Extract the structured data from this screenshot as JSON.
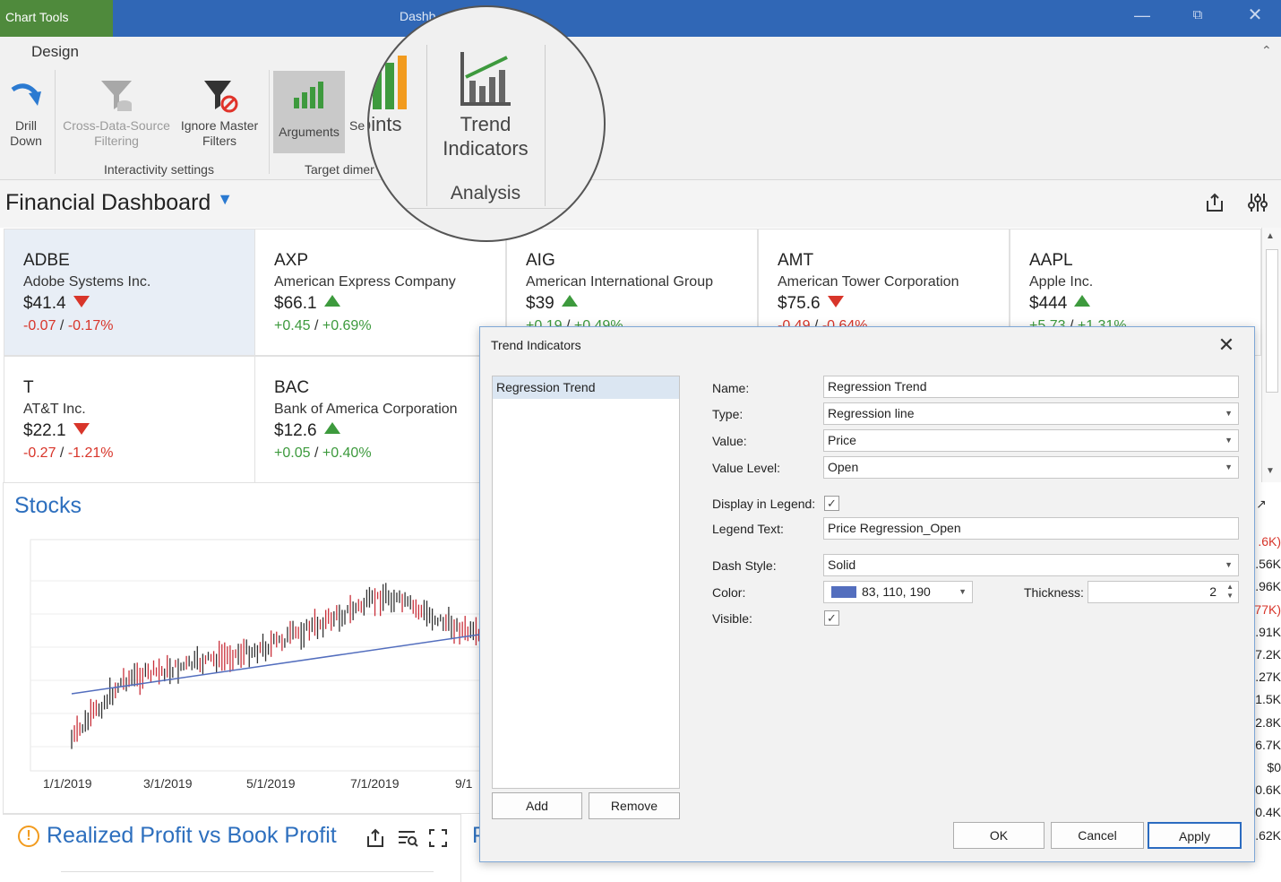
{
  "window": {
    "context_tab": "Chart Tools",
    "title": "Dashb",
    "min_icon": "minimize-icon",
    "restore_icon": "restore-icon",
    "close_icon": "close-icon"
  },
  "ribbon": {
    "tab": "Design",
    "buttons": [
      {
        "l1": "Drill",
        "l2": "Down"
      },
      {
        "l1": "Cross-Data-Source",
        "l2": "Filtering"
      },
      {
        "l1": "Ignore Master",
        "l2": "Filters"
      },
      {
        "l1": "Arguments"
      },
      {
        "l1": "Se"
      }
    ],
    "groups": {
      "interactivity": "Interactivity settings",
      "target": "Target dimer"
    },
    "magnifier": {
      "points": "oints",
      "trend_l1": "Trend",
      "trend_l2": "Indicators",
      "analysis": "Analysis"
    }
  },
  "dashboard": {
    "title": "Financial Dashboard",
    "filter_icon": "filter-icon",
    "export_icon": "export-icon",
    "settings_icon": "parameters-icon"
  },
  "tiles": [
    {
      "ticker": "ADBE",
      "name": "Adobe Systems Inc.",
      "price": "$41.4",
      "dir": "down",
      "delta": "-0.07",
      "pct": "-0.17%"
    },
    {
      "ticker": "AXP",
      "name": "American Express Company",
      "price": "$66.1",
      "dir": "up",
      "delta": "+0.45",
      "pct": "+0.69%"
    },
    {
      "ticker": "AIG",
      "name": "American International Group",
      "price": "$39",
      "dir": "up",
      "delta": "+0.19",
      "pct": "+0.49%"
    },
    {
      "ticker": "AMT",
      "name": "American Tower Corporation",
      "price": "$75.6",
      "dir": "down",
      "delta": "-0.49",
      "pct": "-0.64%"
    },
    {
      "ticker": "AAPL",
      "name": "Apple Inc.",
      "price": "$444",
      "dir": "up",
      "delta": "+5.73",
      "pct": "+1.31%"
    },
    {
      "ticker": "T",
      "name": "AT&T Inc.",
      "price": "$22.1",
      "dir": "down",
      "delta": "-0.27",
      "pct": "-1.21%"
    },
    {
      "ticker": "BAC",
      "name": "Bank of America Corporation",
      "price": "$12.6",
      "dir": "up",
      "delta": "+0.05",
      "pct": "+0.40%"
    }
  ],
  "stocks": {
    "title": "Stocks",
    "x_ticks": [
      "1/1/2019",
      "3/1/2019",
      "5/1/2019",
      "7/1/2019",
      "9/1"
    ]
  },
  "profit": {
    "title": "Realized Profit vs Book Profit",
    "warn_icon": "warning-icon",
    "export_icon": "export-icon",
    "filter_icon": "filter-list-icon",
    "expand_icon": "expand-icon",
    "cut_letter": "P"
  },
  "right_values": [
    ".6K)",
    ".56K",
    ".96K",
    ".77K)",
    ".91K",
    "7.2K",
    ".27K",
    "1.5K",
    "2.8K",
    "6.7K",
    "$0",
    "0.6K",
    "0.4K",
    ".62K"
  ],
  "dialog": {
    "title": "Trend Indicators",
    "list": [
      "Regression Trend"
    ],
    "add": "Add",
    "remove": "Remove",
    "labels": {
      "name": "Name:",
      "type": "Type:",
      "value": "Value:",
      "level": "Value Level:",
      "legend": "Display in Legend:",
      "legend_text": "Legend Text:",
      "dash": "Dash Style:",
      "color": "Color:",
      "thickness": "Thickness:",
      "visible": "Visible:"
    },
    "values": {
      "name": "Regression Trend",
      "type": "Regression line",
      "value": "Price",
      "level": "Open",
      "legend_text": "Price Regression_Open",
      "dash": "Solid",
      "color": "83, 110, 190",
      "color_hex": "#536ebe",
      "thickness": "2"
    },
    "checks": {
      "legend": true,
      "visible": true
    },
    "ok": "OK",
    "cancel": "Cancel",
    "apply": "Apply"
  }
}
